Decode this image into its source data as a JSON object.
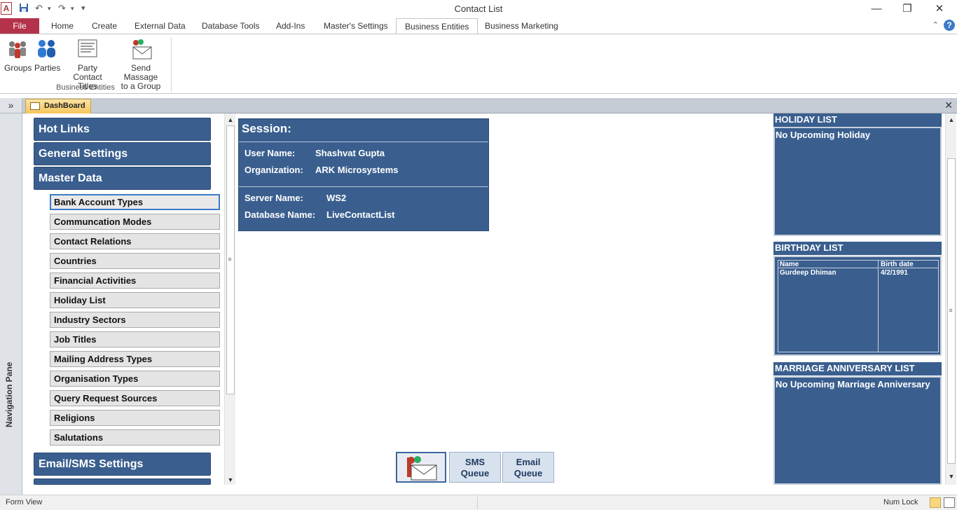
{
  "window": {
    "title": "Contact List",
    "app_icon": "A",
    "minimize": "—",
    "restore": "❐",
    "close": "✕"
  },
  "ribbon_tabs": {
    "file": "File",
    "home": "Home",
    "create": "Create",
    "external_data": "External Data",
    "database_tools": "Database Tools",
    "add_ins": "Add-Ins",
    "masters_settings": "Master's Settings",
    "business_entities": "Business Entities",
    "business_marketing": "Business Marketing",
    "active": "Business Entities"
  },
  "ribbon": {
    "groups": "Groups",
    "parties": "Parties",
    "party_contact_titles_line1": "Party Contact",
    "party_contact_titles_line2": "Titles",
    "send_massage_line1": "Send Massage",
    "send_massage_line2": "to a Group",
    "group_label": "Business Entities"
  },
  "nav_pane": {
    "expand": "»",
    "label": "Navigation Pane"
  },
  "doc_tab": {
    "label": "DashBoard",
    "close": "✕"
  },
  "menu": {
    "hot_links": "Hot Links",
    "general_settings": "General Settings",
    "master_data": "Master Data",
    "email_sms_settings": "Email/SMS Settings",
    "items": [
      "Bank Account Types",
      "Communcation Modes",
      "Contact Relations",
      "Countries",
      "Financial Activities",
      "Holiday List",
      "Industry Sectors",
      "Job Titles",
      "Mailing Address Types",
      "Organisation Types",
      "Query Request Sources",
      "Religions",
      "Salutations"
    ]
  },
  "session": {
    "title": "Session:",
    "user_name_label": "User Name:",
    "user_name": "Shashvat Gupta",
    "organization_label": "Organization:",
    "organization": "ARK Microsystems",
    "server_name_label": "Server Name:",
    "server_name": "WS2",
    "database_name_label": "Database Name:",
    "database_name": "LiveContactList"
  },
  "queue_buttons": {
    "sms_line1": "SMS",
    "sms_line2": "Queue",
    "email_line1": "Email",
    "email_line2": "Queue"
  },
  "holiday_list": {
    "title": "HOLIDAY LIST",
    "message": "No Upcoming Holiday"
  },
  "birthday_list": {
    "title": "BIRTHDAY LIST",
    "col_name": "Name",
    "col_date": "Birth date",
    "rows": [
      {
        "name": "Gurdeep Dhiman",
        "date": "4/2/1991"
      }
    ]
  },
  "anniversary_list": {
    "title": "MARRIAGE ANNIVERSARY LIST",
    "message": "No Upcoming Marriage Anniversary"
  },
  "status": {
    "left": "Form View",
    "num_lock": "Num Lock"
  },
  "colors": {
    "panel_blue": "#3a5f8f",
    "file_tab": "#b4324a",
    "doc_tab": "#f7c65a"
  }
}
